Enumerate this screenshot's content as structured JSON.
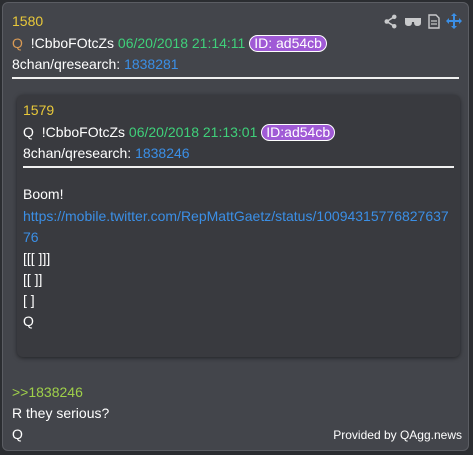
{
  "post": {
    "number": "1580",
    "author_prefix": "Q",
    "tripcode": "!CbboFOtcZs",
    "datetime": "06/20/2018 21:14:11",
    "id_badge": "ID: ad54cb",
    "board_label": "8chan/qresearch:",
    "thread_link": "1838281",
    "reply_ref": ">>1838246",
    "body_lines": [
      "R they serious?",
      "Q"
    ]
  },
  "quoted": {
    "number": "1579",
    "author_prefix": "Q",
    "tripcode": "!CbboFOtcZs",
    "datetime": "06/20/2018 21:13:01",
    "id_badge": "ID:ad54cb",
    "board_label": "8chan/qresearch:",
    "thread_link": "1838246",
    "body_first": "Boom!",
    "link_line1": "https://mobile.twitter.com/RepMattGaetz/status/10094315776827637",
    "link_line2": "76",
    "body_lines": [
      "[[[ ]]]",
      "[[ ]]",
      "[ ]",
      "Q"
    ]
  },
  "toolbar": {
    "icons": [
      "share-icon",
      "glasses-icon",
      "document-icon",
      "move-icon"
    ]
  },
  "footer": {
    "provided_by": "Provided by QAgg.news"
  },
  "colors": {
    "number": "#e8c83a",
    "tripcode": "#ffffff",
    "datetime": "#3fd07a",
    "link": "#3b8fe6",
    "badge": "#a05ad6",
    "reply_ref": "#9fd04a"
  }
}
